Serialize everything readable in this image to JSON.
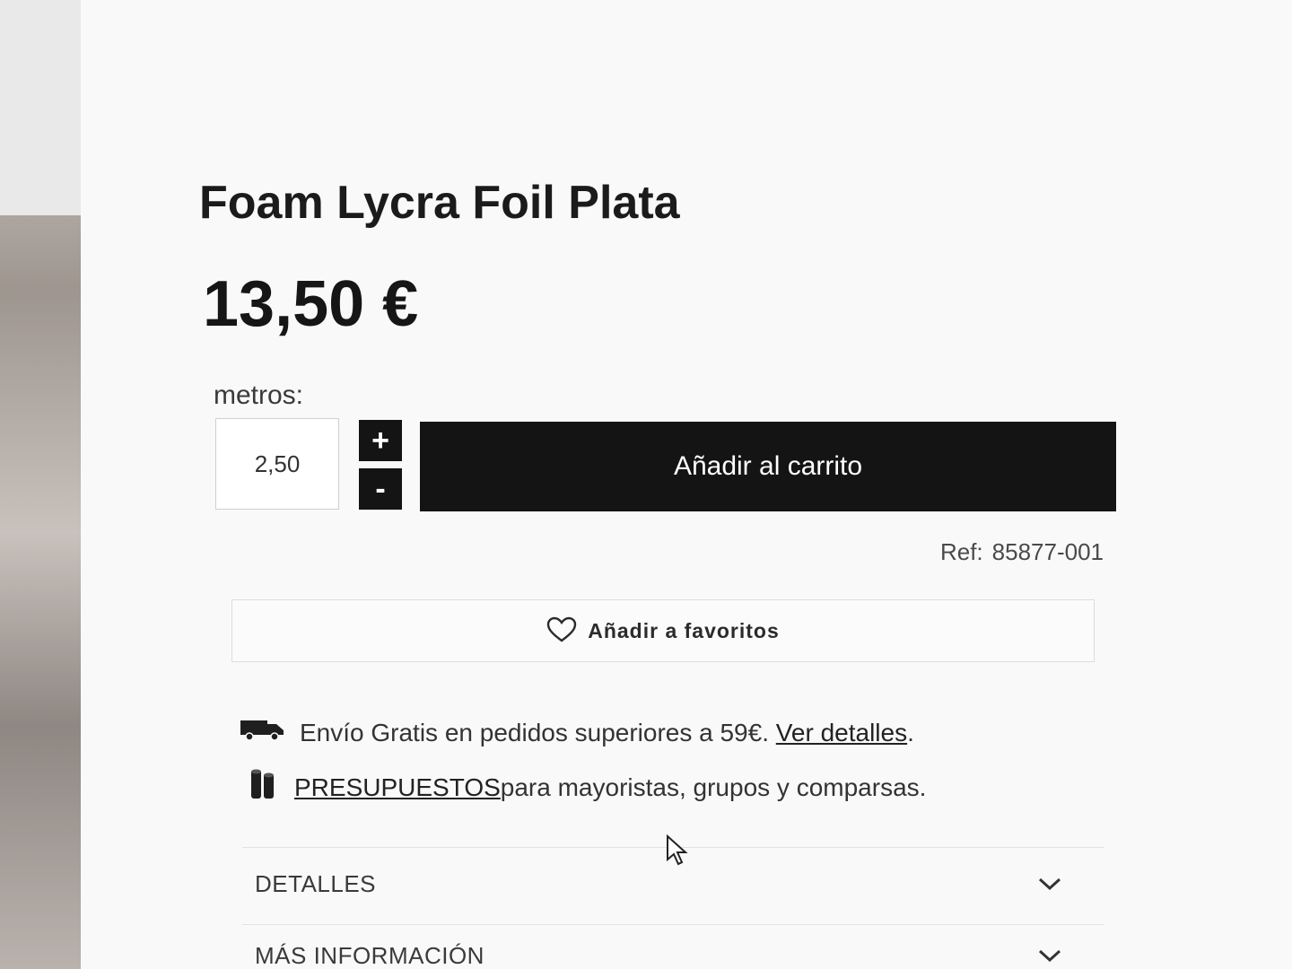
{
  "product": {
    "title": "Foam Lycra Foil Plata",
    "price": "13,50 €"
  },
  "quantity": {
    "label": "metros:",
    "value": "2,50",
    "plus_label": "+",
    "minus_label": "-"
  },
  "cart": {
    "add_label": "Añadir al carrito"
  },
  "reference": {
    "label": "Ref:",
    "value": "85877-001"
  },
  "favorites": {
    "label": "Añadir a favoritos",
    "icon": "heart-icon"
  },
  "shipping": {
    "icon": "truck-icon",
    "text": "Envío Gratis en pedidos superiores a 59€.",
    "link_text": "Ver detalles",
    "suffix": "."
  },
  "quotes": {
    "icon": "fabric-rolls-icon",
    "link_text": "PRESUPUESTOS",
    "text": "para mayoristas, grupos y comparsas."
  },
  "accordions": [
    {
      "label": "DETALLES",
      "icon": "chevron-down-icon"
    },
    {
      "label": "MÁS INFORMACIÓN",
      "icon": "chevron-down-icon"
    }
  ],
  "colors": {
    "button_bg": "#141414",
    "button_text": "#ffffff",
    "text_primary": "#1b1b1b"
  }
}
